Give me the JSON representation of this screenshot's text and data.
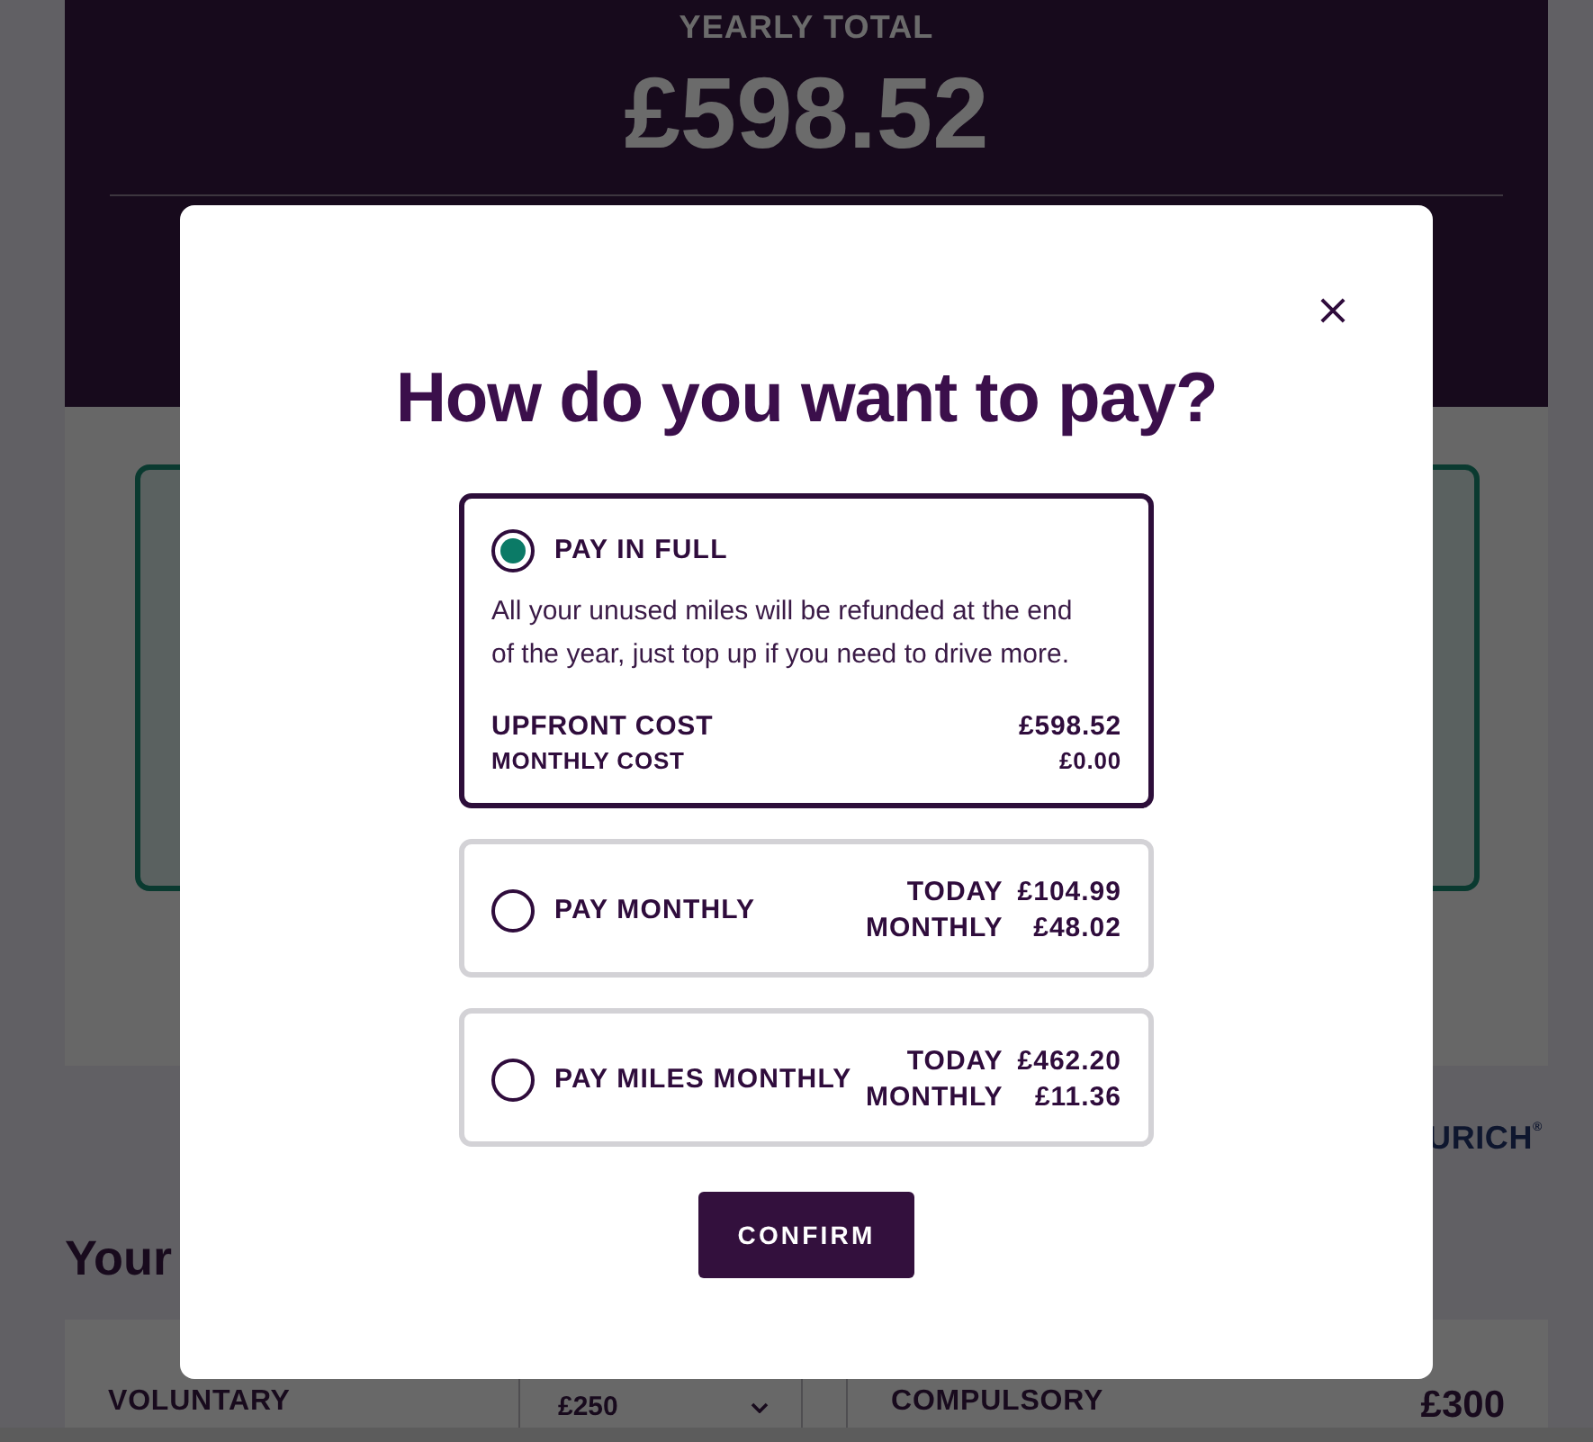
{
  "page": {
    "summary": {
      "label": "YEARLY TOTAL",
      "amount": "£598.52"
    },
    "logo": "URICH$^{®}$",
    "heading": "Your",
    "excess": [
      {
        "kind": "select",
        "label": "VOLUNTARY",
        "value": "£250"
      },
      {
        "kind": "value",
        "label": "COMPULSORY",
        "value": "£300"
      }
    ]
  },
  "modal": {
    "title": "How do you want to pay?",
    "options": [
      {
        "kind": "detailed",
        "label": "PAY IN FULL",
        "selected": true,
        "description": "All your unused miles will be refunded at the end of the year, just top up if you need to drive more.",
        "prices": [
          {
            "label": "UPFRONT COST",
            "value": "£598.52"
          },
          {
            "label": "MONTHLY COST",
            "value": "£0.00"
          }
        ]
      },
      {
        "kind": "compact",
        "label": "PAY MONTHLY",
        "selected": false,
        "prices": [
          {
            "label": "TODAY",
            "value": "£104.99"
          },
          {
            "label": "MONTHLY",
            "value": "£48.02"
          }
        ]
      },
      {
        "kind": "compact",
        "label": "PAY MILES MONTHLY",
        "selected": false,
        "prices": [
          {
            "label": "TODAY",
            "value": "£462.20"
          },
          {
            "label": "MONTHLY",
            "value": "£11.36"
          }
        ]
      }
    ],
    "confirm_button": "CONFIRM"
  }
}
